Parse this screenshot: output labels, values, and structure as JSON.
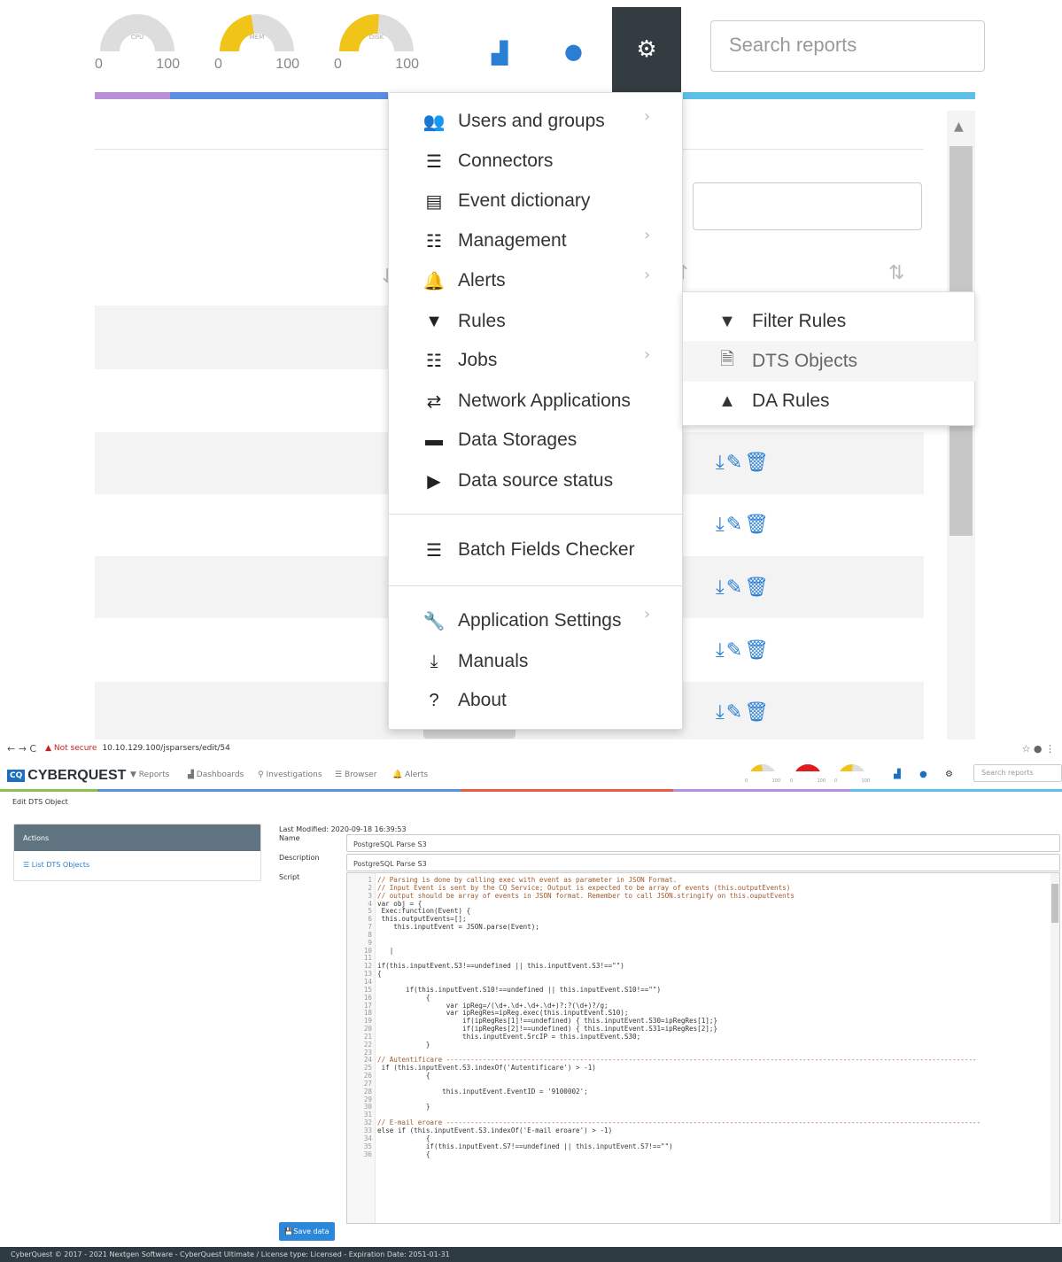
{
  "zoom": {
    "gauges": [
      {
        "label": "CPU",
        "min": "0",
        "max": "100",
        "fill_pct": 0
      },
      {
        "label": "MEM",
        "min": "0",
        "max": "100",
        "fill_pct": 45
      },
      {
        "label": "DISK",
        "min": "0",
        "max": "100",
        "fill_pct": 52
      }
    ],
    "search_placeholder": "Search reports",
    "menu": {
      "items": [
        {
          "label": "Users and groups",
          "icon": "users-icon"
        },
        {
          "label": "Connectors",
          "icon": "database-icon"
        },
        {
          "label": "Event dictionary",
          "icon": "book-icon"
        },
        {
          "label": "Management",
          "icon": "tasks-icon"
        },
        {
          "label": "Alerts",
          "icon": "bell-icon"
        },
        {
          "label": "Rules",
          "icon": "filter-icon"
        },
        {
          "label": "Jobs",
          "icon": "tasks-icon"
        },
        {
          "label": "Network Applications",
          "icon": "exchange-icon"
        },
        {
          "label": "Data Storages",
          "icon": "hdd-icon"
        },
        {
          "label": "Data source status",
          "icon": "play-circle-icon"
        },
        {
          "label": "Batch Fields Checker",
          "icon": "database-icon"
        },
        {
          "label": "Application Settings",
          "icon": "wrench-icon"
        },
        {
          "label": "Manuals",
          "icon": "download-icon"
        },
        {
          "label": "About",
          "icon": "question-circle-icon"
        }
      ],
      "submenu": [
        {
          "label": "Filter Rules",
          "icon": "filter-icon"
        },
        {
          "label": "DTS Objects",
          "icon": "file-code-icon"
        },
        {
          "label": "DA Rules",
          "icon": "tree-icon"
        }
      ]
    }
  },
  "browser": {
    "not_secure": "Not secure",
    "url": "10.10.129.100/jsparsers/edit/54"
  },
  "app": {
    "brand": "CYBERQUEST",
    "brand_badge": "CQ",
    "nav": [
      "Reports",
      "Dashboards",
      "Investigations",
      "Browser",
      "Alerts"
    ],
    "search_placeholder": "Search reports",
    "mini_gauges": [
      {
        "min": "0",
        "max": "100",
        "color": "#f0c419"
      },
      {
        "min": "0",
        "max": "100",
        "color": "#e01b1b"
      },
      {
        "min": "0",
        "max": "100",
        "color": "#f0c419"
      }
    ]
  },
  "page": {
    "title": "Edit DTS Object",
    "panel_header": "Actions",
    "panel_link": "List DTS Objects",
    "last_modified": "Last Modified: 2020-09-18 16:39:53",
    "name_label": "Name",
    "name_value": "PostgreSQL Parse S3",
    "description_label": "Description",
    "description_value": "PostgreSQL Parse S3",
    "script_label": "Script",
    "save_label": "Save data",
    "footer": "CyberQuest © 2017 - 2021 Nextgen Software - CyberQuest Ultimate / License type: Licensed - Expiration Date: 2051-01-31"
  },
  "code_lines": [
    "// Parsing is done by calling exec with event as parameter in JSON Format.",
    "// Input Event is sent by the CQ Service; Output is expected to be array of events (this.outputEvents)",
    "// output should be array of events in JSON format. Remember to call JSON.stringify on this.ouputEvents",
    "var obj = {",
    " Exec:function(Event) {",
    " this.outputEvents=[];",
    "    this.inputEvent = JSON.parse(Event);",
    "",
    "",
    "   |",
    "",
    "if(this.inputEvent.S3!==undefined || this.inputEvent.S3!==\"\")",
    "{",
    "",
    "       if(this.inputEvent.S10!==undefined || this.inputEvent.S10!==\"\")",
    "            {",
    "                 var ipReg=/(\\d+.\\d+.\\d+.\\d+)?:?(\\d+)?/g;",
    "                 var ipRegRes=ipReg.exec(this.inputEvent.S10);",
    "                     if(ipRegRes[1]!==undefined) { this.inputEvent.S30=ipRegRes[1];}",
    "                     if(ipRegRes[2]!==undefined) { this.inputEvent.S31=ipRegRes[2];}",
    "                     this.inputEvent.SrcIP = this.inputEvent.S30;",
    "            }",
    "",
    "// Autentificare -----------------------------------------------------------------------------------------------------------------------------------",
    " if (this.inputEvent.S3.indexOf('Autentificare') > -1)",
    "            {",
    "",
    "                this.inputEvent.EventID = '9100002';",
    "",
    "            }",
    "",
    "// E-mail eroare ------------------------------------------------------------------------------------------------------------------------------------",
    "else if (this.inputEvent.S3.indexOf('E-mail eroare') > -1)",
    "            {",
    "            if(this.inputEvent.S7!==undefined || this.inputEvent.S7!==\"\")",
    "            {"
  ]
}
